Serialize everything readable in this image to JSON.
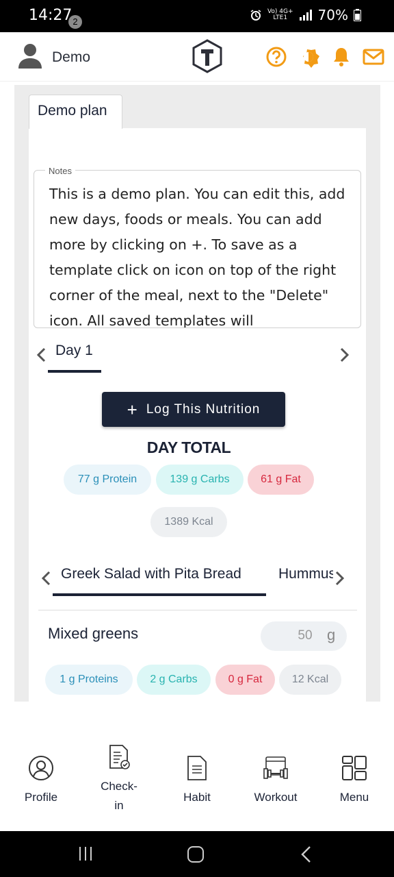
{
  "status_bar": {
    "time": "14:27",
    "notification_count": "2",
    "network_top": "Vo) 4G+",
    "network_bottom": "LTE1",
    "battery": "70%"
  },
  "header": {
    "username": "Demo",
    "icons": [
      "avatar-icon",
      "logo-icon",
      "help-icon",
      "theme-icon",
      "bell-icon",
      "mail-icon"
    ],
    "accent_color": "#f29b15"
  },
  "plan": {
    "tab_label": "Demo plan",
    "notes_label": "Notes",
    "notes_text": "This is a demo plan. You can edit this, add new days, foods or meals. You can add more by clicking on +. To save as a template click on icon on top of the right corner of the meal, next to the \"Delete\" icon.  All saved templates will"
  },
  "day": {
    "label": "Day 1"
  },
  "log_button": {
    "plus": "+",
    "label": "Log This Nutrition"
  },
  "day_total": {
    "title": "DAY TOTAL",
    "protein": "77 g Protein",
    "carbs": "139 g Carbs",
    "fat": "61 g Fat",
    "kcal": "1389 Kcal"
  },
  "meals": {
    "tabs": [
      "Greek Salad with Pita Bread",
      "Hummus"
    ]
  },
  "food": {
    "name": "Mixed greens",
    "quantity": "50",
    "unit": "g",
    "protein": "1 g Proteins",
    "carbs": "2 g Carbs",
    "fat": "0 g Fat",
    "kcal": "12 Kcal"
  },
  "bottom_nav": {
    "items": [
      {
        "label": "Profile",
        "icon": "profile-icon"
      },
      {
        "label": "Check-\nin",
        "icon": "checkin-icon"
      },
      {
        "label": "Habit",
        "icon": "habit-icon"
      },
      {
        "label": "Workout",
        "icon": "workout-icon"
      },
      {
        "label": "Menu",
        "icon": "menu-grid-icon"
      }
    ]
  },
  "colors": {
    "primary": "#1b2438",
    "protein": "#2a8fb8",
    "carbs": "#28b3b0",
    "fat": "#d6283e",
    "kcal": "#7d8590"
  }
}
